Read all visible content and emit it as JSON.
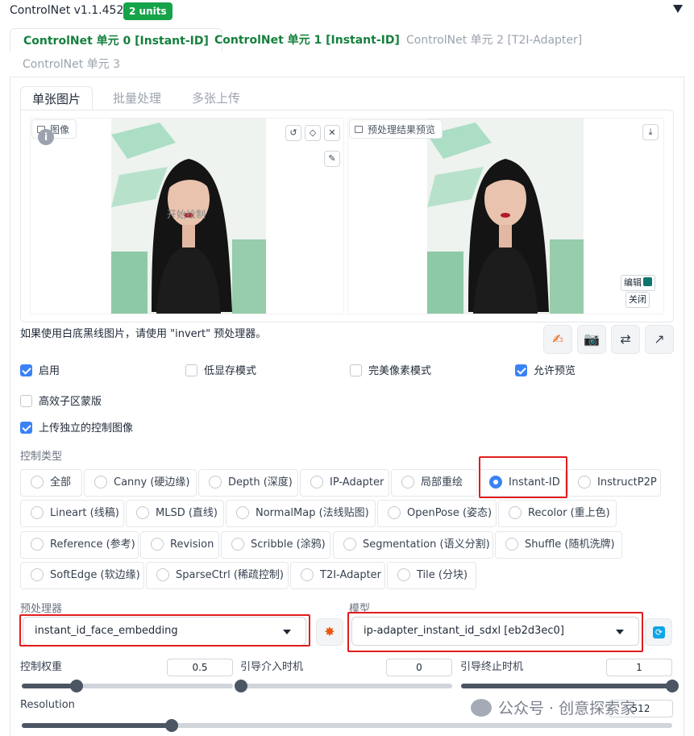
{
  "header": {
    "title": "ControlNet v1.1.452",
    "badge": "2 units"
  },
  "unit_tabs": [
    {
      "label": "ControlNet 单元 0 [Instant-ID]"
    },
    {
      "label": "ControlNet 单元 1 [Instant-ID]"
    },
    {
      "label": "ControlNet 单元 2 [T2I-Adapter]"
    },
    {
      "label": "ControlNet 单元 3"
    }
  ],
  "image_tabs": [
    {
      "label": "单张图片"
    },
    {
      "label": "批量处理"
    },
    {
      "label": "多张上传"
    }
  ],
  "input_image": {
    "label": "图像",
    "info": "i",
    "start_drawing": "开始绘制"
  },
  "preview_image": {
    "label": "预处理结果预览",
    "edit": "编辑",
    "close": "关闭"
  },
  "hint": "如果使用白底黑线图片，请使用 \"invert\" 预处理器。",
  "checkboxes": {
    "enable": {
      "label": "启用",
      "checked": true
    },
    "low_vram": {
      "label": "低显存模式",
      "checked": false
    },
    "pixel_perfect": {
      "label": "完美像素模式",
      "checked": false
    },
    "allow_preview": {
      "label": "允许预览",
      "checked": true
    },
    "effective_mask": {
      "label": "高效子区蒙版",
      "checked": false
    },
    "upload_independent": {
      "label": "上传独立的控制图像",
      "checked": true
    }
  },
  "control_type": {
    "label": "控制类型",
    "selected": "Instant-ID",
    "options": [
      [
        "全部",
        "Canny (硬边缘)",
        "Depth (深度)",
        "IP-Adapter",
        "局部重绘",
        "Instant-ID",
        "InstructP2P"
      ],
      [
        "Lineart (线稿)",
        "MLSD (直线)",
        "NormalMap (法线贴图)",
        "OpenPose (姿态)",
        "Recolor (重上色)"
      ],
      [
        "Reference (参考)",
        "Revision",
        "Scribble (涂鸦)",
        "Segmentation (语义分割)",
        "Shuffle (随机洗牌)"
      ],
      [
        "SoftEdge (软边缘)",
        "SparseCtrl (稀疏控制)",
        "T2I-Adapter",
        "Tile (分块)"
      ]
    ]
  },
  "preprocessor": {
    "label": "预处理器",
    "value": "instant_id_face_embedding"
  },
  "model": {
    "label": "模型",
    "value": "ip-adapter_instant_id_sdxl [eb2d3ec0]"
  },
  "sliders": {
    "weight": {
      "label": "控制权重",
      "value": "0.5",
      "fraction": 0.26
    },
    "start": {
      "label": "引导介入时机",
      "value": "0",
      "fraction": 0.0
    },
    "end": {
      "label": "引导终止时机",
      "value": "1",
      "fraction": 1.0
    },
    "resolution": {
      "label": "Resolution",
      "value": "512",
      "fraction": 0.23
    }
  },
  "watermark": "公众号 · 创意探索家",
  "colors": {
    "accent": "#16a34a",
    "checked": "#3b82f6",
    "highlight": "#e11d1d"
  }
}
